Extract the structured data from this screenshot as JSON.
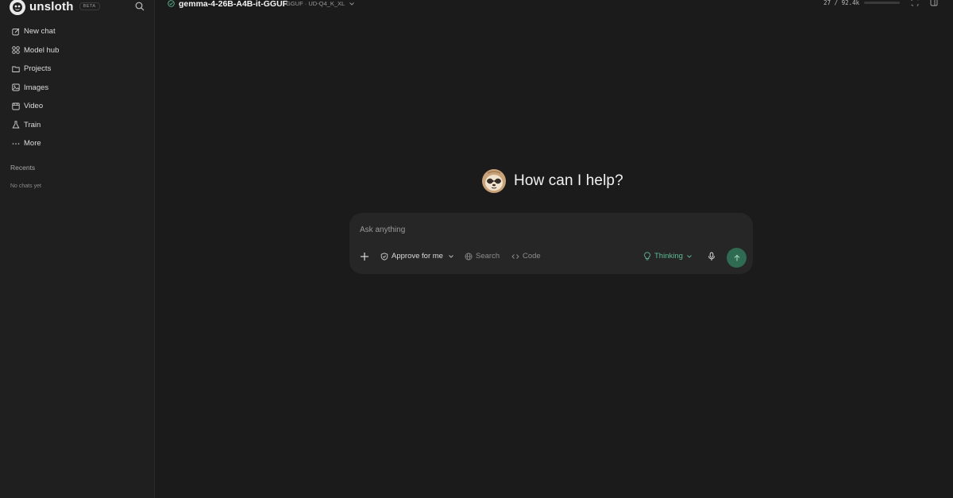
{
  "sidebar": {
    "brand": "unsloth",
    "badge": "BETA",
    "items": [
      {
        "label": "New chat",
        "icon": "edit-icon"
      },
      {
        "label": "Model hub",
        "icon": "grid-icon"
      },
      {
        "label": "Projects",
        "icon": "folder-icon"
      },
      {
        "label": "Images",
        "icon": "image-icon"
      },
      {
        "label": "Video",
        "icon": "video-icon"
      },
      {
        "label": "Train",
        "icon": "flask-icon"
      },
      {
        "label": "More",
        "icon": "more-icon"
      }
    ],
    "recents_label": "Recents",
    "recents_empty": "No chats yet"
  },
  "topbar": {
    "model_name": "gemma-4-26B-A4B-it-GGUF",
    "model_meta": "GGUF · UD-Q4_K_XL",
    "context_count": "27 / 92.4k",
    "context_fraction": 0.0003
  },
  "main": {
    "greeting": "How can I help?"
  },
  "composer": {
    "placeholder": "Ask anything",
    "approve_label": "Approve for me",
    "search_label": "Search",
    "code_label": "Code",
    "thinking_label": "Thinking"
  },
  "colors": {
    "background": "#1b1b1b",
    "sidebar": "#1f1f1f",
    "composer": "#262626",
    "accent_green": "#5fba95",
    "send_button": "#2f6b52"
  }
}
